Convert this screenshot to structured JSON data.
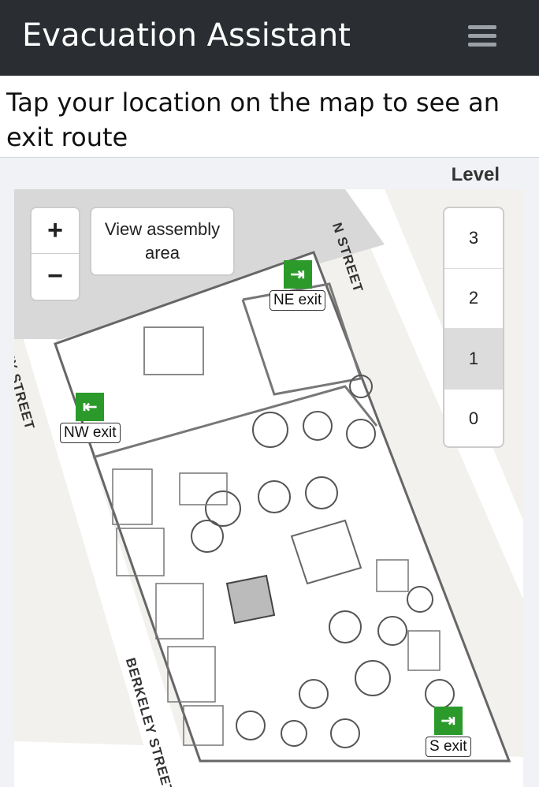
{
  "app": {
    "title": "Evacuation Assistant",
    "menu_icon": "hamburger-icon"
  },
  "instruction": "Tap your location on the map to see an exit route",
  "map": {
    "zoom_in": "+",
    "zoom_out": "−",
    "assembly_button": "View assembly area",
    "level_label": "Level",
    "levels": [
      "3",
      "2",
      "1",
      "0"
    ],
    "active_level": "1",
    "exits": [
      {
        "label": "NE exit",
        "icon": "exit-sign-icon"
      },
      {
        "label": "NW exit",
        "icon": "exit-sign-icon"
      },
      {
        "label": "S exit",
        "icon": "exit-sign-icon"
      }
    ],
    "streets": [
      "N STREET",
      "LEY STREET",
      "BERKELEY STREET"
    ],
    "colors": {
      "exit_green": "#2b9a2b",
      "navbar": "#2a2e33"
    }
  }
}
